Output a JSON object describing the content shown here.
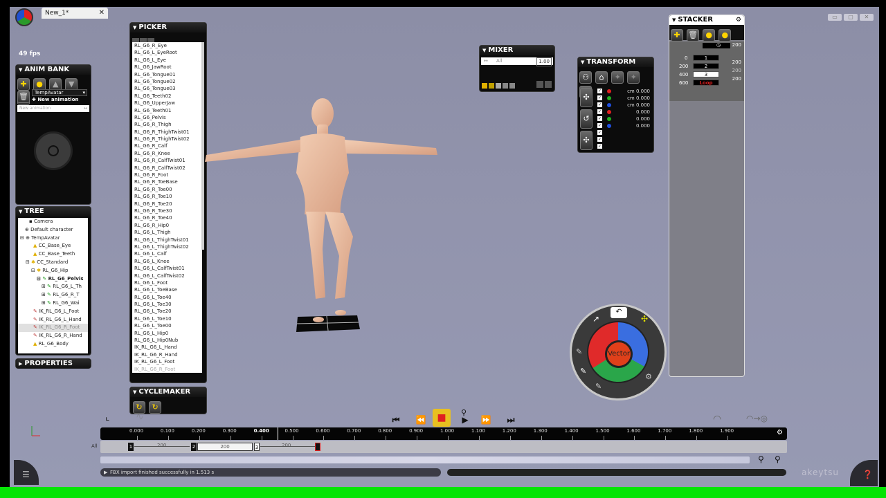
{
  "colors": {
    "green_bar": "#05e405",
    "viewport_bg": "#9294ad",
    "record": "#e02020"
  },
  "tab": {
    "title": "New_1*",
    "close": "✕"
  },
  "window_buttons": [
    "▭",
    "▢",
    "✕"
  ],
  "fps": "49 fps",
  "anim_bank": {
    "title": "ANIM BANK",
    "avatar": "TempAvatar",
    "new_animation": "New animation",
    "placeholder": "New animation"
  },
  "tree": {
    "title": "TREE",
    "items": [
      "Camera",
      "Default character",
      "TempAvatar",
      "CC_Base_Eye",
      "CC_Base_Teeth",
      "CC_Standard",
      "RL_G6_Hip",
      "RL_G6_Pelvis",
      "RL_G6_L_Th",
      "RL_G6_R_T",
      "RL_G6_Wai",
      "IK_RL_G6_L_Foot",
      "IK_RL_G6_L_Hand",
      "IK_RL_G6_R_Foot",
      "IK_RL_G6_R_Hand",
      "RL_G6_Body"
    ]
  },
  "properties": {
    "title": "PROPERTIES"
  },
  "picker": {
    "title": "PICKER",
    "items": [
      "RL_G6_R_Eye",
      "RL_G6_L_EyeRoot",
      "RL_G6_L_Eye",
      "RL_G6_JawRoot",
      "RL_G6_Tongue01",
      "RL_G6_Tongue02",
      "RL_G6_Tongue03",
      "RL_G6_Teeth02",
      "RL_G6_UpperJaw",
      "RL_G6_Teeth01",
      "RL_G6_Pelvis",
      "RL_G6_R_Thigh",
      "RL_G6_R_ThighTwist01",
      "RL_G6_R_ThighTwist02",
      "RL_G6_R_Calf",
      "RL_G6_R_Knee",
      "RL_G6_R_CalfTwist01",
      "RL_G6_R_CalfTwist02",
      "RL_G6_R_Foot",
      "RL_G6_R_ToeBase",
      "RL_G6_R_Toe00",
      "RL_G6_R_Toe10",
      "RL_G6_R_Toe20",
      "RL_G6_R_Toe30",
      "RL_G6_R_Toe40",
      "RL_G6_R_Hip0",
      "RL_G6_L_Thigh",
      "RL_G6_L_ThighTwist01",
      "RL_G6_L_ThighTwist02",
      "RL_G6_L_Calf",
      "RL_G6_L_Knee",
      "RL_G6_L_CalfTwist01",
      "RL_G6_L_CalfTwist02",
      "RL_G6_L_Foot",
      "RL_G6_L_ToeBase",
      "RL_G6_L_Toe40",
      "RL_G6_L_Toe30",
      "RL_G6_L_Toe20",
      "RL_G6_L_Toe10",
      "RL_G6_L_Toe00",
      "RL_G6_L_Hip0",
      "RL_G6_L_Hip0Nub",
      "IK_RL_G6_L_Hand",
      "IK_RL_G6_R_Hand",
      "IK_RL_G6_L_Foot",
      "IK_RL_G6_R_Foot"
    ]
  },
  "cyclemaker": {
    "title": "CYCLEMAKER"
  },
  "mixer": {
    "title": "MIXER",
    "track": "All",
    "value": "1.00"
  },
  "transform": {
    "title": "TRANSFORM",
    "rows": [
      "cm 0.000",
      "cm 0.000",
      "cm 0.000",
      "0.000",
      "0.000",
      "0.000",
      "",
      "",
      ""
    ]
  },
  "stacker": {
    "title": "STACKER",
    "header_value": "200",
    "labels": [
      "0",
      "200",
      "400",
      "600"
    ],
    "tracks": [
      "1",
      "2",
      "3"
    ],
    "loop": "Loop",
    "right_values": [
      "200",
      "200",
      "200"
    ]
  },
  "wheel": {
    "center": "Vector"
  },
  "timeline": {
    "ticks": [
      "0.000",
      "0.100",
      "0.200",
      "0.300",
      "0.400",
      "0.500",
      "0.600",
      "0.700",
      "0.800",
      "0.900",
      "1.000",
      "1.100",
      "1.200",
      "1.300",
      "1.400",
      "1.500",
      "1.600",
      "1.700",
      "1.800",
      "1.900"
    ],
    "current": "0.400",
    "track_label": "All",
    "clips": [
      {
        "num": "1",
        "label": "200"
      },
      {
        "num": "2",
        "label": "200"
      },
      {
        "num": "3",
        "label": "200"
      }
    ]
  },
  "playback": [
    "⏮",
    "⏪",
    "■",
    "▶",
    "⏩",
    "⏭"
  ],
  "status": "FBX import finished successfully in 1.513 s",
  "watermark": "akeytsu"
}
